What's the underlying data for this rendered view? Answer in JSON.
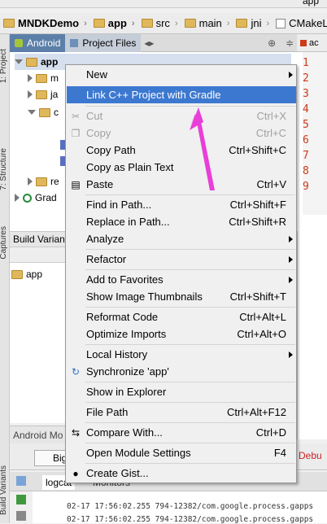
{
  "breadcrumb": [
    "MNDKDemo",
    "app",
    "src",
    "main",
    "jni",
    "CMakeLists"
  ],
  "toolbar": {
    "app_selector": "app"
  },
  "project_panel": {
    "tabs": [
      "Android",
      "Project Files"
    ]
  },
  "tree": {
    "root": "app",
    "children": [
      "m",
      "ja",
      "c",
      "",
      "",
      "re"
    ],
    "gradle": "Grad"
  },
  "side_labels": {
    "project": "1: Project",
    "structure": "7: Structure",
    "captures": "Captures",
    "build_variants": "Build Variants"
  },
  "build_variants": {
    "title": "Build Varian",
    "module": "app"
  },
  "android_monitor": "Android Mo",
  "editor": {
    "tab": "ac",
    "line_numbers": [
      "1",
      "2",
      "3",
      "4",
      "5",
      "6",
      "7",
      "8",
      "9"
    ]
  },
  "bottom": {
    "tab_big": "Big",
    "debug": "Debu",
    "logcat": "logcat",
    "monitors": "Monitors"
  },
  "log_lines": [
    "02-17 17:56:02.255 794-12382/com.google.process.gapps",
    "02-17 17:56:02.255 794-12382/com.google.process.gapps"
  ],
  "menu": {
    "items": [
      {
        "label": "New",
        "shortcut": "",
        "submenu": true
      },
      {
        "label": "Link C++ Project with Gradle",
        "shortcut": "",
        "highlight": true
      },
      {
        "label": "Cut",
        "shortcut": "Ctrl+X",
        "disabled": true
      },
      {
        "label": "Copy",
        "shortcut": "Ctrl+C",
        "disabled": true
      },
      {
        "label": "Copy Path",
        "shortcut": "Ctrl+Shift+C"
      },
      {
        "label": "Copy as Plain Text",
        "shortcut": ""
      },
      {
        "label": "Paste",
        "shortcut": "Ctrl+V"
      },
      {
        "label": "Find in Path...",
        "shortcut": "Ctrl+Shift+F"
      },
      {
        "label": "Replace in Path...",
        "shortcut": "Ctrl+Shift+R"
      },
      {
        "label": "Analyze",
        "shortcut": "",
        "submenu": true
      },
      {
        "label": "Refactor",
        "shortcut": "",
        "submenu": true
      },
      {
        "label": "Add to Favorites",
        "shortcut": "",
        "submenu": true
      },
      {
        "label": "Show Image Thumbnails",
        "shortcut": "Ctrl+Shift+T"
      },
      {
        "label": "Reformat Code",
        "shortcut": "Ctrl+Alt+L"
      },
      {
        "label": "Optimize Imports",
        "shortcut": "Ctrl+Alt+O"
      },
      {
        "label": "Local History",
        "shortcut": "",
        "submenu": true
      },
      {
        "label": "Synchronize 'app'",
        "shortcut": ""
      },
      {
        "label": "Show in Explorer",
        "shortcut": ""
      },
      {
        "label": "File Path",
        "shortcut": "Ctrl+Alt+F12"
      },
      {
        "label": "Compare With...",
        "shortcut": "Ctrl+D"
      },
      {
        "label": "Open Module Settings",
        "shortcut": "F4"
      },
      {
        "label": "Create Gist...",
        "shortcut": ""
      }
    ]
  },
  "colors": {
    "highlight": "#3c78d0",
    "arrow": "#e83fd8",
    "line_numbers": "#cc3a1a"
  }
}
